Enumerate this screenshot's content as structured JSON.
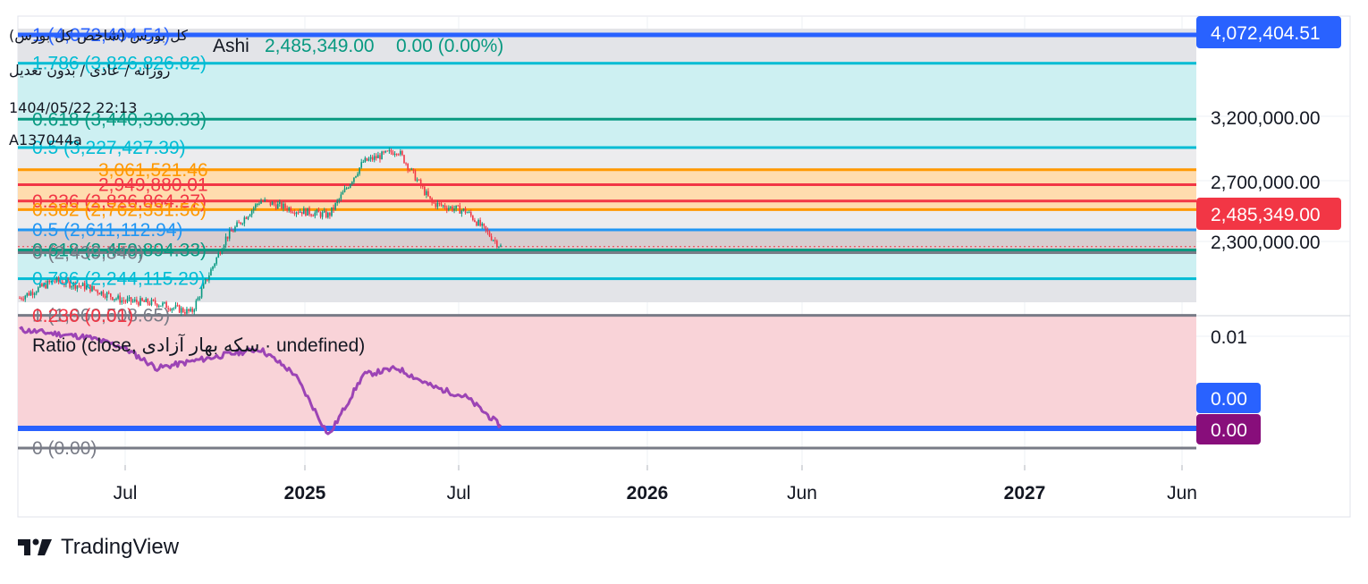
{
  "header": {
    "symbol": "کل بورس (شاخص کل بورس)",
    "interval": "روزانه / عادی / بدون تعدیل",
    "datetime": "1404/05/22 22:13",
    "account": "A137044a",
    "series_type": "Ashi",
    "close_value": "2,485,349.00",
    "change": "0.00 (0.00%)"
  },
  "price_axis": {
    "labels": [
      "3,200,000.00",
      "2,700,000.00",
      "2,300,000.00"
    ],
    "top_badge": "4,072,404.51",
    "last_badge": "2,485,349.00"
  },
  "fib_left": [
    {
      "label": "1 (4,072,404.51)",
      "value": 4072404.51,
      "color": "#2962ff"
    },
    {
      "label": "1.786 (3,826,826.82)",
      "value": 3860000,
      "color": "#00bcd4"
    },
    {
      "label": "0.618 (3,440,330.33)",
      "value": 3440330.33,
      "color": "#089981"
    },
    {
      "label": "0.5 (3,227,427.39)",
      "value": 3227427.39,
      "color": "#00bcd4"
    },
    {
      "label": "0.236 (2,826,864.27)",
      "value": 2826864.27,
      "color": "#f23645"
    },
    {
      "label": "0.382 (2,762,331.56)",
      "value": 2762331.56,
      "color": "#ff9800"
    },
    {
      "label": "0.5 (2,611,112.94)",
      "value": 2611112.94,
      "color": "#2196f3"
    },
    {
      "label": "0.618 (2,459,894.33)",
      "value": 2459894.33,
      "color": "#089981"
    },
    {
      "label": "0 (2,439,840)",
      "value": 2439840,
      "color": "#787b86"
    },
    {
      "label": "0.786 (2,244,115.29)",
      "value": 2244115.29,
      "color": "#00bcd4"
    },
    {
      "label": "1 (1,969,508.65)",
      "value": 1969508.65,
      "color": "#787b86"
    }
  ],
  "fib_right": [
    {
      "label": "3,061,521.46",
      "value": 3061521.46,
      "color": "#ff9800"
    },
    {
      "label": "2,949,880.01",
      "value": 2949880.01,
      "color": "#f23645"
    }
  ],
  "ratio_panel": {
    "title": "Ratio (close, سکه بهار آزادی · undefined)",
    "axis_label": "0.01",
    "badge_blue": "0.00",
    "badge_purple": "0.00",
    "fib_top_label": "0.236 (0.01)",
    "fib_bottom_label": "0 (0.00)"
  },
  "time_axis": [
    {
      "label": "Jul",
      "bold": false
    },
    {
      "label": "2025",
      "bold": true
    },
    {
      "label": "Jul",
      "bold": false
    },
    {
      "label": "2026",
      "bold": true
    },
    {
      "label": "Jun",
      "bold": false
    },
    {
      "label": "2027",
      "bold": true
    },
    {
      "label": "Jun",
      "bold": false
    }
  ],
  "brand": "TradingView",
  "colors": {
    "up": "#089981",
    "down": "#f23645",
    "ratio_line": "#9c44b5",
    "blue_badge": "#2962ff",
    "red_badge": "#f23645",
    "purple_badge": "#880e7b"
  },
  "chart_data": [
    {
      "type": "line",
      "series_style": "heikin-ashi candles",
      "title": "",
      "x": [
        "2024-06",
        "2024-07",
        "2024-08",
        "2024-09",
        "2024-10",
        "2024-11",
        "2024-12",
        "2025-01",
        "2025-02",
        "2025-03",
        "2025-04",
        "2025-05",
        "2025-06",
        "2025-07",
        "2025-08"
      ],
      "series": [
        {
          "name": "Ashi",
          "values": [
            2100000,
            2230000,
            2180000,
            2080000,
            2060000,
            1990000,
            2550000,
            2830000,
            2760000,
            2720000,
            3120000,
            3210000,
            2810000,
            2750000,
            2485349
          ]
        }
      ],
      "ylim": [
        1950000,
        4100000
      ],
      "ylabel": ""
    },
    {
      "type": "line",
      "title": "Ratio (close, سکه بهار آزادی · undefined)",
      "x": [
        "2024-06",
        "2024-07",
        "2024-08",
        "2024-09",
        "2024-10",
        "2024-11",
        "2024-12",
        "2025-01",
        "2025-02",
        "2025-03",
        "2025-04",
        "2025-05",
        "2025-06",
        "2025-07",
        "2025-08"
      ],
      "series": [
        {
          "name": "Ratio",
          "values": [
            0.0122,
            0.0118,
            0.0114,
            0.0104,
            0.0082,
            0.0089,
            0.0096,
            0.0102,
            0.0076,
            0.0012,
            0.0075,
            0.0082,
            0.0063,
            0.0052,
            0.0022
          ]
        }
      ],
      "ylim": [
        0,
        0.013
      ]
    }
  ]
}
